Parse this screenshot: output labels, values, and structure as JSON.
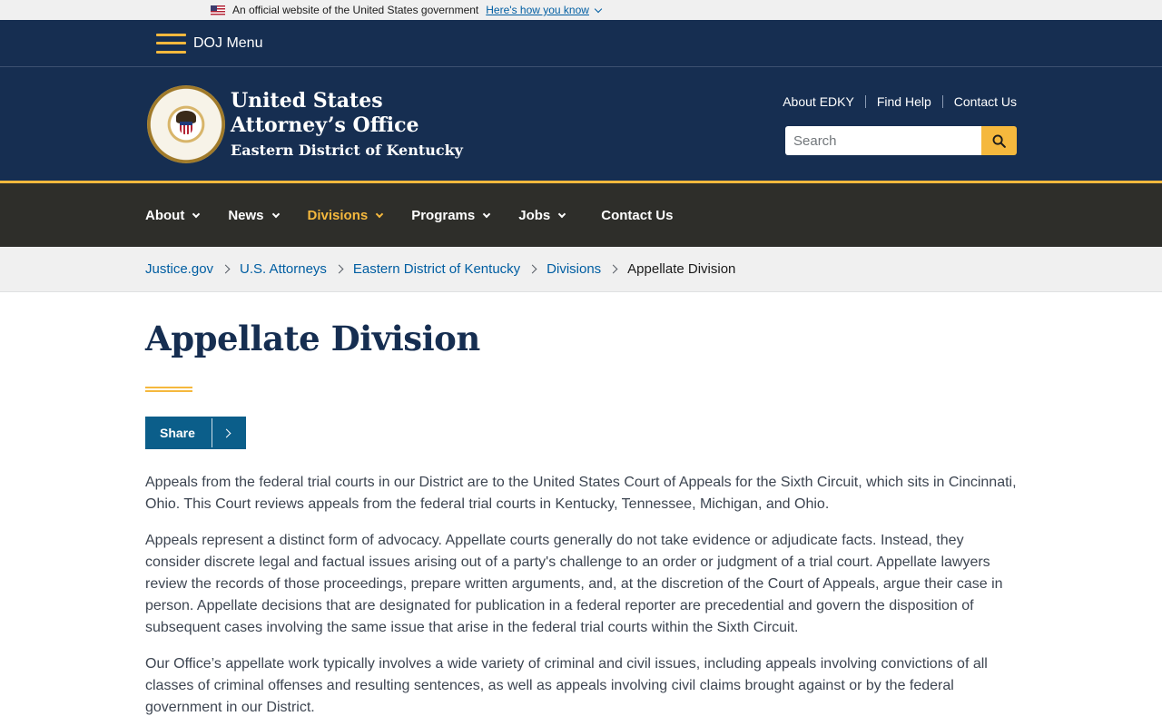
{
  "gov_banner": {
    "text": "An official website of the United States government",
    "link_label": "Here's how you know"
  },
  "doj_menu": {
    "label": "DOJ Menu"
  },
  "header": {
    "office_line1": "United States",
    "office_line2": "Attorney’s Office",
    "office_line3": "Eastern District of Kentucky",
    "util_links": [
      "About EDKY",
      "Find Help",
      "Contact Us"
    ],
    "search_placeholder": "Search"
  },
  "nav": {
    "items": [
      {
        "label": "About"
      },
      {
        "label": "News"
      },
      {
        "label": "Divisions"
      },
      {
        "label": "Programs"
      },
      {
        "label": "Jobs"
      },
      {
        "label": "Contact Us"
      }
    ]
  },
  "breadcrumb": {
    "items": [
      "Justice.gov",
      "U.S. Attorneys",
      "Eastern District of Kentucky",
      "Divisions"
    ],
    "current": "Appellate Division"
  },
  "main": {
    "title": "Appellate Division",
    "share_label": "Share",
    "paragraphs": [
      "Appeals from the federal trial courts in our District are to the United States Court of Appeals for the Sixth Circuit, which sits in Cincinnati, Ohio.  This Court reviews appeals from the federal trial courts in Kentucky, Tennessee, Michigan, and Ohio.",
      "Appeals represent a distinct form of advocacy.  Appellate courts generally do not take evidence or adjudicate facts.  Instead, they consider discrete legal and factual issues arising out of a party's challenge to an order or judgment of a trial court.  Appellate lawyers review the records of those proceedings, prepare written arguments, and, at the discretion of the Court of Appeals, argue their case in person.  Appellate decisions that are designated for publication in a federal reporter are precedential and govern the disposition of subsequent cases involving the same issue that arise in the federal trial courts within the Sixth Circuit.",
      "Our Office’s appellate work typically involves a wide variety of criminal and civil issues, including appeals involving convictions of all classes of criminal offenses and resulting sentences, as well as appeals involving civil claims brought against or by the federal government in our District."
    ]
  },
  "colors": {
    "navy": "#162e51",
    "gold": "#f5b83d",
    "nav_bg": "#2e2e2a",
    "link_blue": "#005ea2",
    "share_blue": "#0b5e8a"
  },
  "icons": [
    "us-flag-icon",
    "chevron-down-icon",
    "menu-icon",
    "doj-seal-logo",
    "search-icon",
    "chevron-right-icon"
  ]
}
